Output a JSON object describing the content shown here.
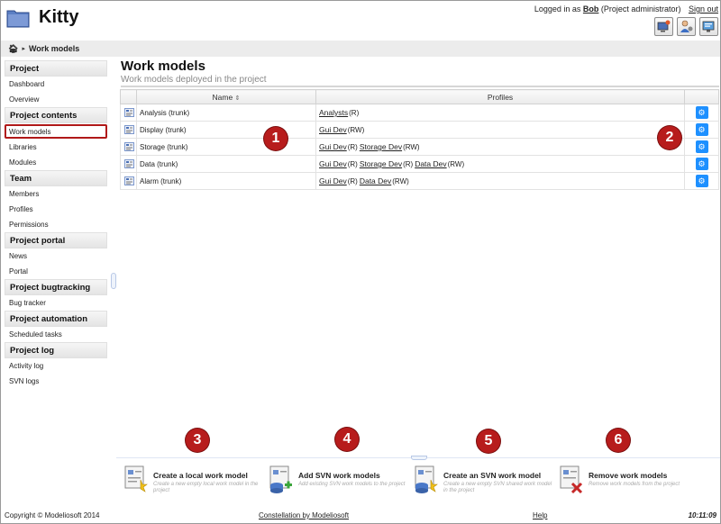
{
  "app": {
    "title": "Kitty"
  },
  "header": {
    "logged_in_prefix": "Logged in as",
    "user": "Bob",
    "role": "(Project administrator)",
    "sign_out": "Sign out",
    "buttons": [
      "admin-computer-icon",
      "user-admin-icon",
      "monitor-settings-icon"
    ]
  },
  "breadcrumb": {
    "current": "Work models"
  },
  "sidebar": {
    "sections": [
      {
        "title": "Project",
        "items": [
          "Dashboard",
          "Overview"
        ]
      },
      {
        "title": "Project contents",
        "items": [
          "Work models",
          "Libraries",
          "Modules"
        ]
      },
      {
        "title": "Team",
        "items": [
          "Members",
          "Profiles",
          "Permissions"
        ]
      },
      {
        "title": "Project portal",
        "items": [
          "News",
          "Portal"
        ]
      },
      {
        "title": "Project bugtracking",
        "items": [
          "Bug tracker"
        ]
      },
      {
        "title": "Project automation",
        "items": [
          "Scheduled tasks"
        ]
      },
      {
        "title": "Project log",
        "items": [
          "Activity log",
          "SVN logs"
        ]
      }
    ],
    "active_item": "Work models"
  },
  "main": {
    "title": "Work models",
    "subtitle": "Work models deployed in the project",
    "columns": {
      "name": "Name",
      "name_sort_glyph": "⇕",
      "profiles": "Profiles"
    },
    "rows": [
      {
        "name": "Analysis (trunk)",
        "profiles": [
          {
            "name": "Analysts",
            "perm": "(R)"
          }
        ]
      },
      {
        "name": "Display (trunk)",
        "profiles": [
          {
            "name": "Gui Dev",
            "perm": "(RW)"
          }
        ]
      },
      {
        "name": "Storage (trunk)",
        "profiles": [
          {
            "name": "Gui Dev",
            "perm": "(R)"
          },
          {
            "name": "Storage Dev",
            "perm": "(RW)"
          }
        ]
      },
      {
        "name": "Data (trunk)",
        "profiles": [
          {
            "name": "Gui Dev",
            "perm": "(R)"
          },
          {
            "name": "Storage Dev",
            "perm": "(R)"
          },
          {
            "name": "Data Dev",
            "perm": "(RW)"
          }
        ]
      },
      {
        "name": "Alarm (trunk)",
        "profiles": [
          {
            "name": "Gui Dev",
            "perm": "(R)"
          },
          {
            "name": "Data Dev",
            "perm": "(RW)"
          }
        ]
      }
    ]
  },
  "markers": [
    "1",
    "2",
    "3",
    "4",
    "5",
    "6"
  ],
  "actions": [
    {
      "title": "Create a local work model",
      "desc": "Create a new empty local work model in the project"
    },
    {
      "title": "Add SVN work models",
      "desc": "Add existing SVN work models to the project"
    },
    {
      "title": "Create an SVN work model",
      "desc": "Create a new empty SVN shared work model in the project"
    },
    {
      "title": "Remove work models",
      "desc": "Remove work models from the project"
    }
  ],
  "footer": {
    "copyright": "Copyright © Modeliosoft 2014",
    "constellation": "Constellation by Modeliosoft",
    "help": "Help",
    "clock": "10:11:09"
  },
  "colors": {
    "marker": "#b71c1c",
    "gear_button": "#1e90ff",
    "active_outline": "#b01818"
  }
}
